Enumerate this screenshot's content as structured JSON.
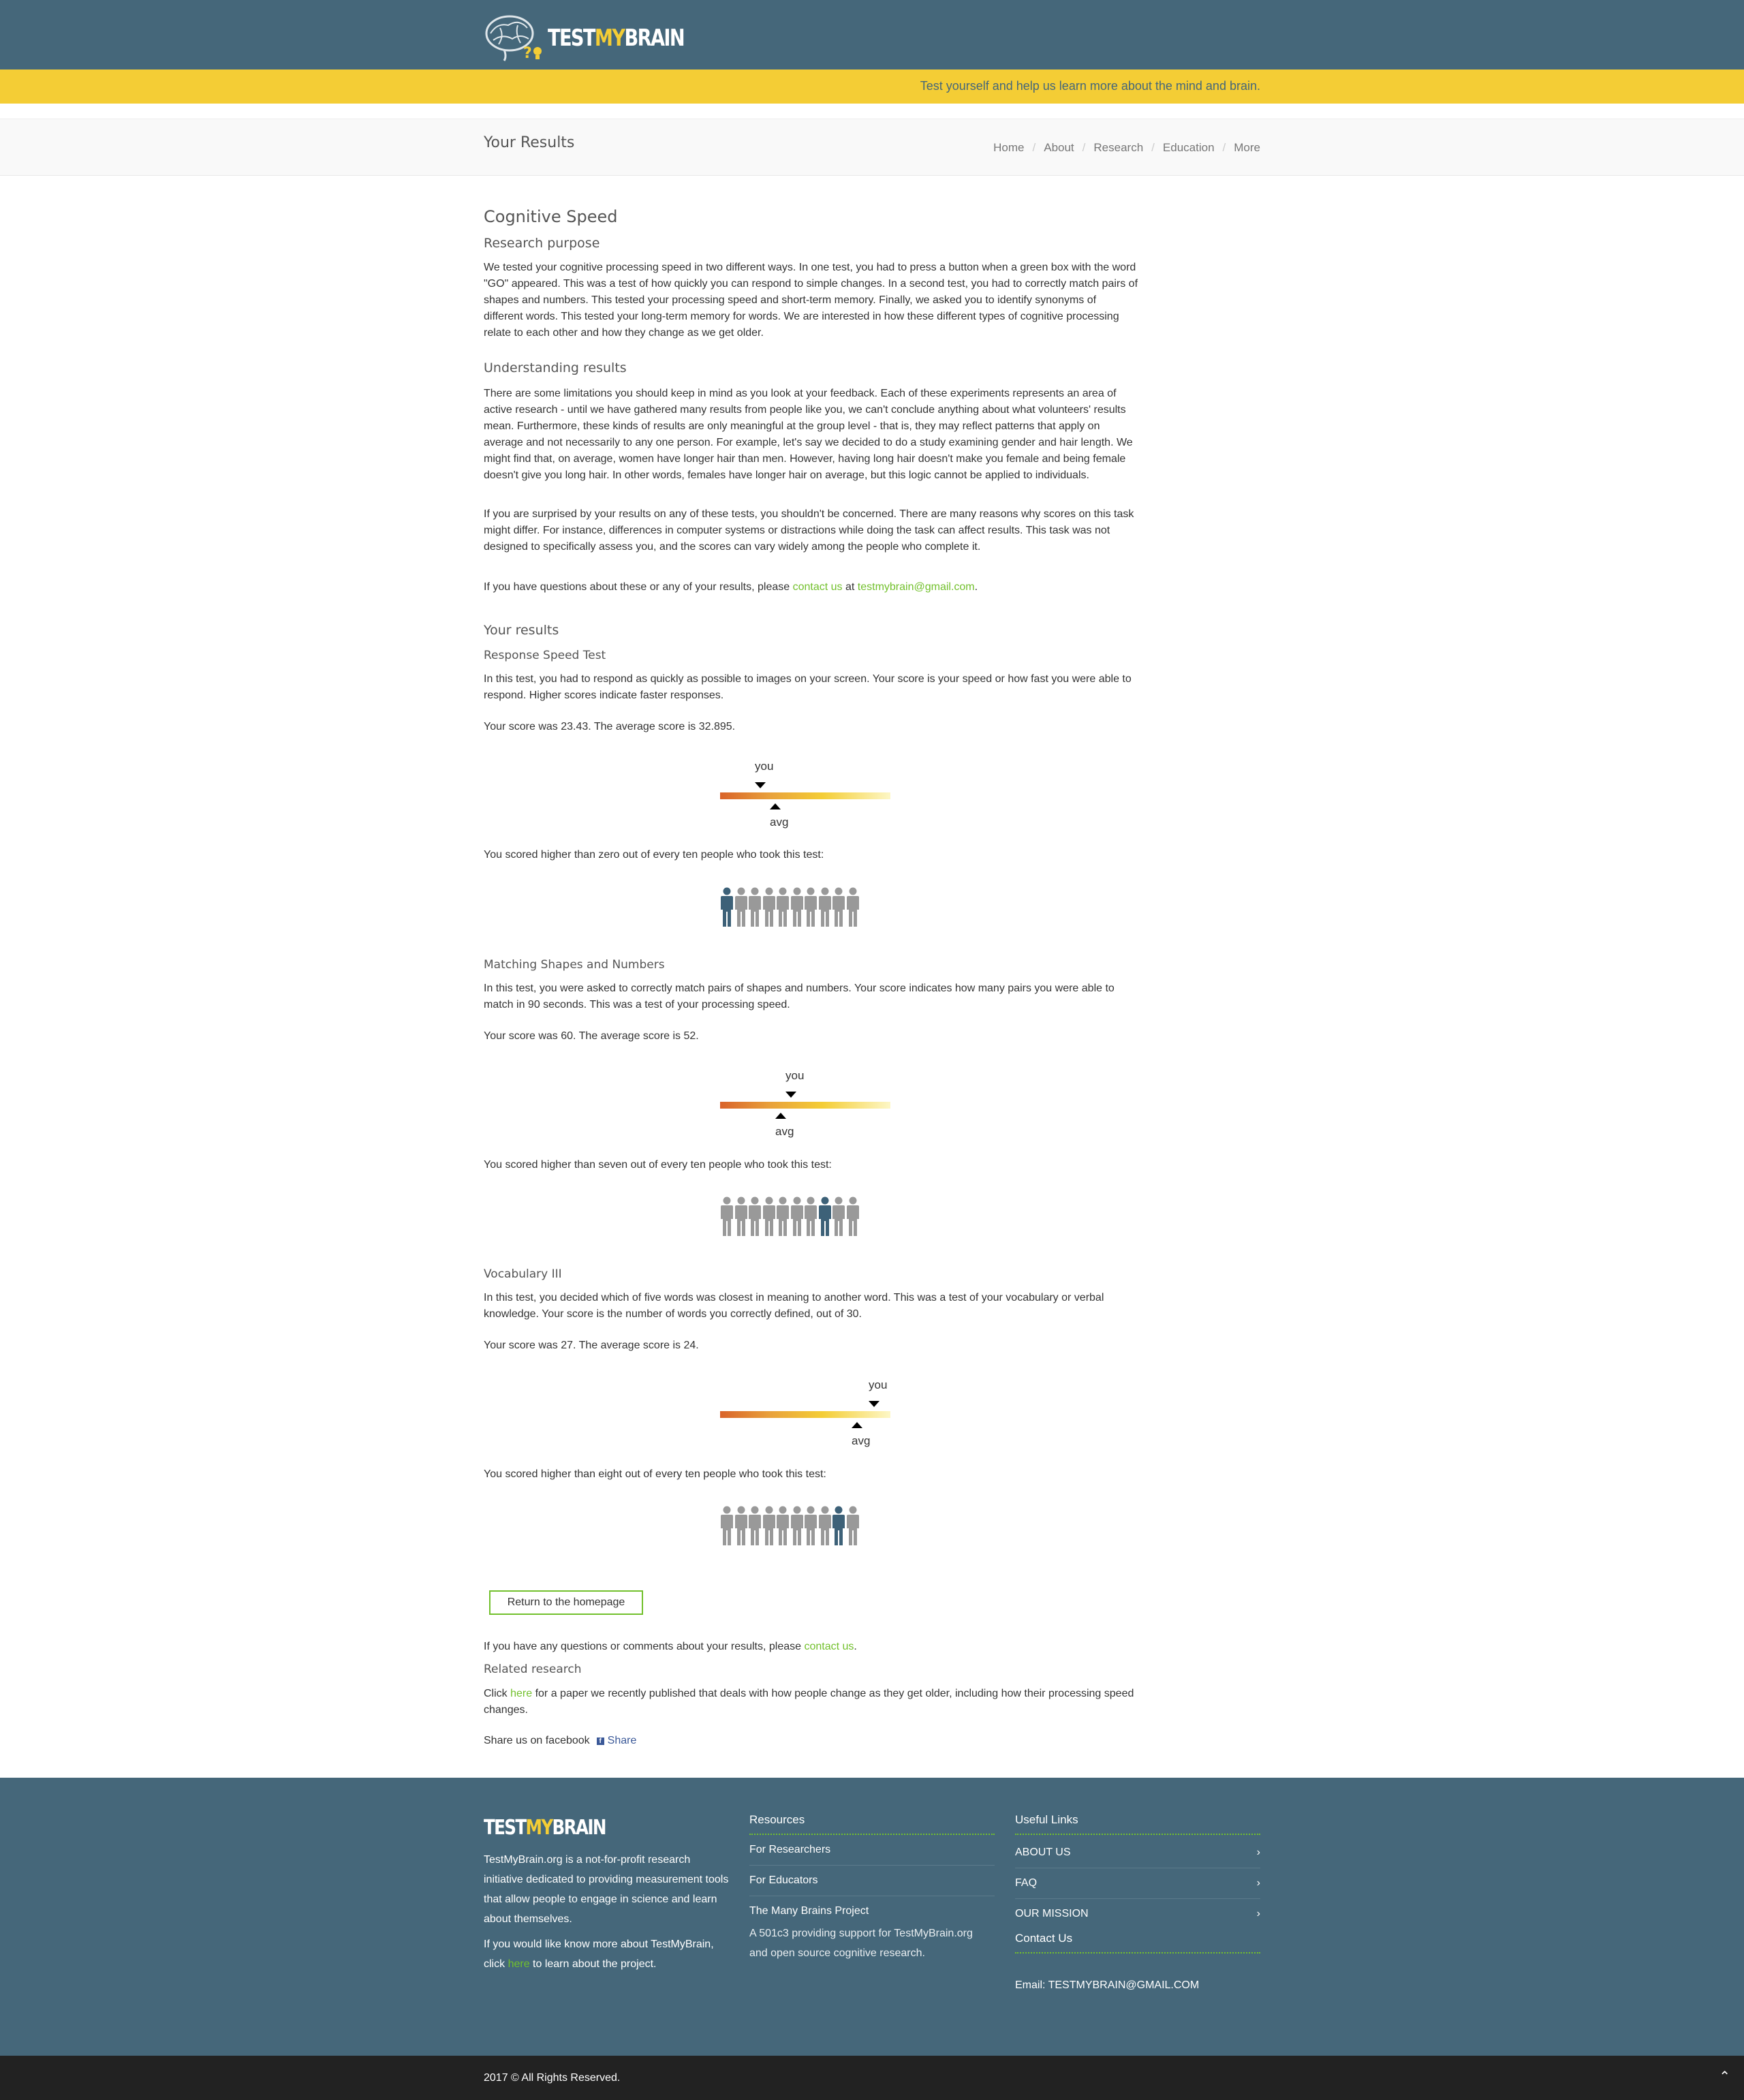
{
  "header": {
    "brand_prefix": "TEST",
    "brand_highlight": "MY",
    "brand_suffix": "BRAIN",
    "tagline": "Test yourself and help us learn more about the mind and brain."
  },
  "breadcrumb": {
    "page_title": "Your Results",
    "items": [
      "Home",
      "About",
      "Research",
      "Education",
      "More"
    ]
  },
  "intro": {
    "title": "Cognitive Speed",
    "purpose_heading": "Research purpose",
    "purpose_text": "We tested your cognitive processing speed in two different ways. In one test, you had to press a button when a green box with the word \"GO\" appeared. This was a test of how quickly you can respond to simple changes. In a second test, you had to correctly match pairs of shapes and numbers. This tested your processing speed and short-term memory. Finally, we asked you to identify synonyms of different words. This tested your long-term memory for words. We are interested in how these different types of cognitive processing relate to each other and how they change as we get older.",
    "understanding_heading": "Understanding results",
    "understanding_p1": "There are some limitations you should keep in mind as you look at your feedback. Each of these experiments represents an area of active research - until we have gathered many results from people like you, we can't conclude anything about what volunteers' results mean. Furthermore, these kinds of results are only meaningful at the group level - that is, they may reflect patterns that apply on average and not necessarily to any one person. For example, let's say we decided to do a study examining gender and hair length. We might find that, on average, women have longer hair than men. However, having long hair doesn't make you female and being female doesn't give you long hair. In other words, females have longer hair on average, but this logic cannot be applied to individuals.",
    "understanding_p2": "If you are surprised by your results on any of these tests, you shouldn't be concerned. There are many reasons why scores on this task might differ. For instance, differences in computer systems or distractions while doing the task can affect results. This task was not designed to specifically assess you, and the scores can vary widely among the people who complete it.",
    "questions_prefix": "If you have questions about these or any of your results, please ",
    "contact_link": "contact us",
    "questions_mid": " at ",
    "email_link": "testmybrain@gmail.com",
    "questions_suffix": "."
  },
  "results": {
    "heading": "Your results",
    "you_label": "you",
    "avg_label": "avg",
    "tests": [
      {
        "name": "Response Speed Test",
        "description": "In this test, you had to respond as quickly as possible to images on your screen. Your score is your speed or how fast you were able to respond. Higher scores indicate faster responses.",
        "score_text": "Your score was 23.43. The average score is 32.895.",
        "score": 23.43,
        "average": 32.895,
        "you_fraction": 0.23,
        "avg_fraction": 0.32,
        "percentile_text": "You scored higher than zero out of every ten people who took this test:",
        "highlight_person": 1
      },
      {
        "name": "Matching Shapes and Numbers",
        "description": "In this test, you were asked to correctly match pairs of shapes and numbers. Your score indicates how many pairs you were able to match in 90 seconds. This was a test of your processing speed.",
        "score_text": "Your score was 60. The average score is 52.",
        "score": 60,
        "average": 52,
        "you_fraction": 0.41,
        "avg_fraction": 0.35,
        "percentile_text": "You scored higher than seven out of every ten people who took this test:",
        "highlight_person": 8
      },
      {
        "name": "Vocabulary III",
        "description": "In this test, you decided which of five words was closest in meaning to another word. This was a test of your vocabulary or verbal knowledge. Your score is the number of words you correctly defined, out of 30.",
        "score_text": "Your score was 27. The average score is 24.",
        "score": 27,
        "average": 24,
        "you_fraction": 0.9,
        "avg_fraction": 0.8,
        "percentile_text": "You scored higher than eight out of every ten people who took this test:",
        "highlight_person": 9
      }
    ],
    "return_button": "Return to the homepage",
    "comments_prefix": "If you have any questions or comments about your results, please ",
    "comments_link": "contact us",
    "comments_suffix": ".",
    "related_heading": "Related research",
    "related_prefix": "Click ",
    "related_link": "here",
    "related_suffix": " for a paper we recently published that deals with how people change as they get older, including how their processing speed changes.",
    "share_text": "Share us on facebook",
    "share_button": "Share"
  },
  "footer": {
    "about_p1": "TestMyBrain.org is a not-for-profit research initiative dedicated to providing measurement tools that allow people to engage in science and learn about themselves.",
    "about_p2_prefix": "If you would like know more about TestMyBrain, click ",
    "about_p2_link": "here",
    "about_p2_suffix": " to learn about the project.",
    "resources_heading": "Resources",
    "resources": [
      "For Researchers",
      "For Educators",
      "The Many Brains Project"
    ],
    "resources_note": "A 501c3 providing support for TestMyBrain.org and open source cognitive research.",
    "useful_heading": "Useful Links",
    "useful_links": [
      "ABOUT US",
      "FAQ",
      "OUR MISSION"
    ],
    "contact_heading": "Contact Us",
    "email_line": "Email: TESTMYBRAIN@GMAIL.COM",
    "copyright": "2017 © All Rights Reserved."
  },
  "colors": {
    "header_bg": "#45677a",
    "tagline_bg": "#f4cd35",
    "accent_green": "#72c02c",
    "person_gray": "#999999",
    "person_highlight": "#3d6178"
  }
}
